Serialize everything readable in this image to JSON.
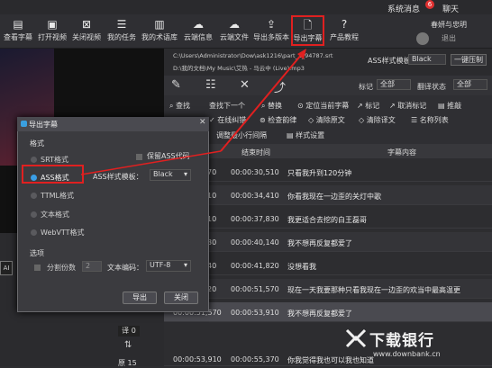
{
  "topbar": {
    "sys_msg": "系统消息",
    "sys_badge": "6",
    "chat": "聊天"
  },
  "toolbar": {
    "items": [
      {
        "label": "查看字幕",
        "icon": "subtitle-view-icon"
      },
      {
        "label": "打开视频",
        "icon": "video-open-icon"
      },
      {
        "label": "关闭视频",
        "icon": "video-close-icon"
      },
      {
        "label": "我的任务",
        "icon": "task-icon"
      },
      {
        "label": "我的术语库",
        "icon": "glossary-icon"
      },
      {
        "label": "云端信息",
        "icon": "cloud-info-icon"
      },
      {
        "label": "云端文件",
        "icon": "cloud-file-icon"
      },
      {
        "label": "导出多版本",
        "icon": "export-multi-icon"
      },
      {
        "label": "导出字幕",
        "icon": "export-subtitle-icon"
      },
      {
        "label": "产品教程",
        "icon": "tutorial-icon"
      }
    ],
    "user_name": "春妍与忠明",
    "logout": "退出"
  },
  "files": {
    "line1": "C:\\Users\\Administrator\\Dow\\ask1216\\part_1_94787.srt",
    "line2": "D:\\我的文档\\My Music\\艾热 - 马云中 (Live).mp3",
    "ass_template_label": "ASS样式模板",
    "ass_template_value": "Black",
    "oneclick_btn": "一键压制"
  },
  "filters": {
    "tag_label": "标记",
    "tag_value": "全部",
    "trans_label": "翻译状态",
    "trans_value": "全部"
  },
  "actions_row1": [
    "查找",
    "查找下一个",
    "替换",
    "定位当前字幕",
    "标记",
    "取消标记",
    "推敲"
  ],
  "actions_row2": [
    "在线纠错",
    "检查韵律",
    "清除原文",
    "清除译文",
    "名称列表"
  ],
  "actions_row3": [
    "调整最小行间隔",
    "样式设置"
  ],
  "table": {
    "headers": {
      "end": "结束时间",
      "content": "字幕内容"
    },
    "rows": [
      {
        "start": "70",
        "end": "00:00:30,510",
        "text": "只看我升到120分钟"
      },
      {
        "start": "10",
        "end": "00:00:34,410",
        "text": "你看我现在一边歪的关灯中歌"
      },
      {
        "start": "10",
        "end": "00:00:37,830",
        "text": "我更适合去挖的白王磊哥"
      },
      {
        "start": "30",
        "end": "00:00:40,140",
        "text": "我不想再反复都爱了"
      },
      {
        "start": "40",
        "end": "00:00:41,820",
        "text": "没想看我"
      },
      {
        "start": "20",
        "end": "00:00:51,570",
        "text": "现在一天我要那种只看我现在一边歪的欢当中最高温更"
      },
      {
        "start": "00:00:51,570",
        "end": "00:00:53,910",
        "text": "我不想再反复都爱了"
      },
      {
        "start": "00:00:53,910",
        "end": "00:00:55,370",
        "text": "你我觉得我也可以我也知道"
      }
    ]
  },
  "left": {
    "box": "AI",
    "count_label": "译 0",
    "count2": "原 15"
  },
  "dialog": {
    "title": "导出字幕",
    "format_label": "格式",
    "formats": [
      "SRT格式",
      "ASS格式",
      "TTML格式",
      "文本格式",
      "WebVTT格式"
    ],
    "selected_format": "ASS格式",
    "keep_ass": "保留ASS代码",
    "template_label": "ASS样式模板：",
    "template_value": "Black",
    "options_label": "选项",
    "split_label": "分割份数",
    "split_value": "2",
    "encoding_label": "文本编码：",
    "encoding_value": "UTF-8",
    "export_btn": "导出",
    "close_btn": "关闭"
  },
  "watermark": {
    "text": "下载银行",
    "url": "www.downbank.cn"
  },
  "colors": {
    "accent": "#3a9ee6",
    "highlight": "#e02020"
  }
}
